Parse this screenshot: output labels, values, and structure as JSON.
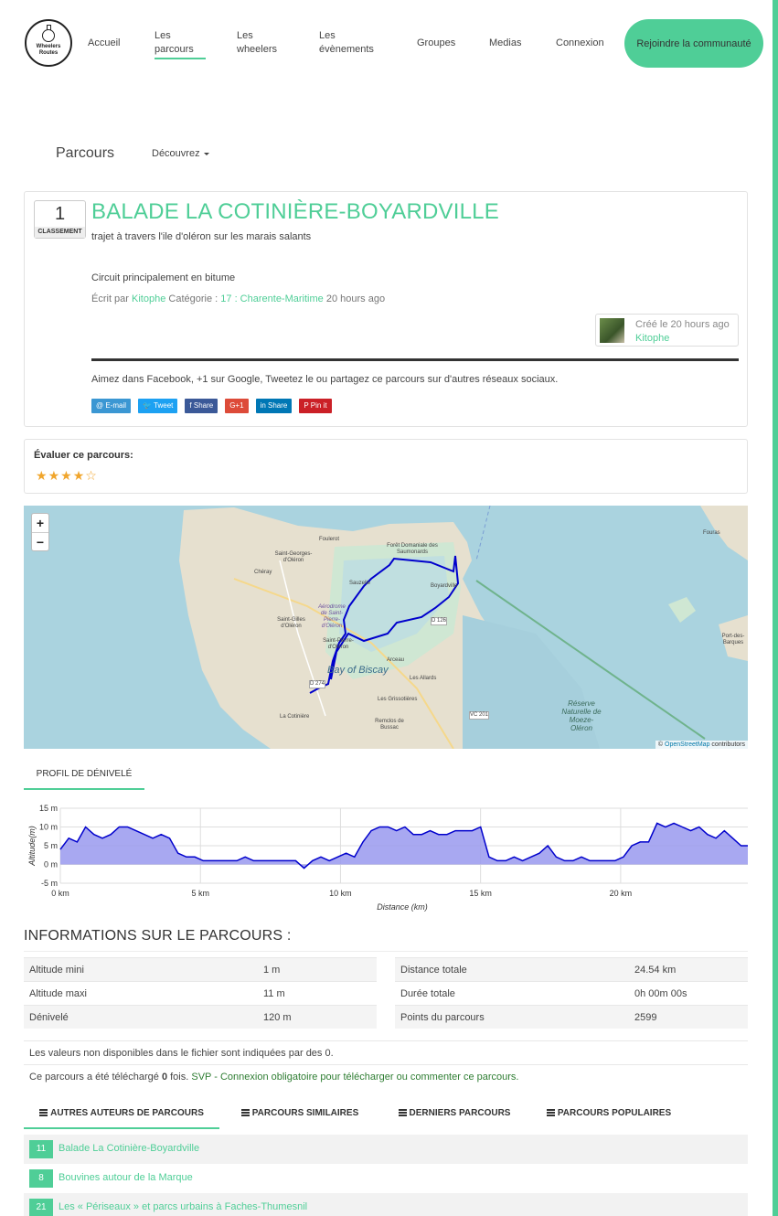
{
  "header": {
    "logo_line1": "Wheelers",
    "logo_line2": "Routes",
    "nav": [
      {
        "label": "Accueil"
      },
      {
        "label": "Les parcours"
      },
      {
        "label": "Les wheelers"
      },
      {
        "label": "Les évènements"
      },
      {
        "label": "Groupes"
      },
      {
        "label": "Medias"
      },
      {
        "label": "Connexion"
      }
    ],
    "join_label": "Rejoindre la communauté",
    "accent_color": "#4fce97"
  },
  "section": {
    "title": "Parcours",
    "discover_label": "Découvrez"
  },
  "route": {
    "rank": "1",
    "rank_label": "CLASSEMENT",
    "title": "BALADE LA COTINIÈRE-BOYARDVILLE",
    "subtitle": "trajet à travers l'ile d'oléron sur les marais salants",
    "description": "Circuit principalement en bitume",
    "written_by": "Écrit par",
    "author": "Kitophe",
    "category_label": "Catégorie :",
    "category": "17 : Charente-Maritime",
    "time_ago": "20 hours ago",
    "created": "Créé le 20 hours ago",
    "share_text": "Aimez dans Facebook, +1 sur Google, Tweetez le ou partagez ce parcours sur d'autres réseaux sociaux.",
    "share_buttons": [
      {
        "label": "@ E-mail",
        "color": "#3b97d3"
      },
      {
        "label": "🐦 Tweet",
        "color": "#1da1f2"
      },
      {
        "label": "f Share",
        "color": "#3b5998"
      },
      {
        "label": "G+1",
        "color": "#dd4b39"
      },
      {
        "label": "in Share",
        "color": "#0077b5"
      },
      {
        "label": "P Pin it",
        "color": "#cb2027"
      }
    ]
  },
  "rating": {
    "title": "Évaluer ce parcours:",
    "value": 4,
    "max": 5
  },
  "map": {
    "zoom_in": "+",
    "zoom_out": "−",
    "attribution_prefix": "©",
    "attribution_link": "OpenStreetMap",
    "attribution_suffix": "contributors",
    "labels": {
      "fouras": "Fouras",
      "foret": "Forêt Domaniale des Saumonards",
      "stgeorges": "Saint-Georges-d'Oléron",
      "cheray": "Chéray",
      "sauzelle": "Sauzelle",
      "boyard": "Boyardville",
      "stgilles": "Saint-Gilles d'Oléron",
      "aero": "Aérodrome de Saint-Pierre-d'Oléron",
      "stpierre": "Saint-Pierre-d'Oléron",
      "arceau": "Arceau",
      "bay": "Bay of Biscay",
      "allards": "Les Allards",
      "grissotieres": "Les Grissotières",
      "cotiniere": "La Cotinière",
      "remigeasse": "Remclos de Bussac",
      "reserve": "Réserve Naturelle de Moeze-Oléron",
      "port": "Port-des-Barques",
      "foulerot": "Foulerot",
      "d126": "D 126",
      "d274": "D 274",
      "vc201": "VC 201"
    }
  },
  "elevation": {
    "tab_label": "PROFIL DE DÉNIVELÉ",
    "ylabel": "Altitude(m)",
    "xlabel": "Distance (km)",
    "y_ticks": [
      "15 m",
      "10 m",
      "5 m",
      "0 m",
      "-5 m"
    ],
    "x_ticks": [
      "0 km",
      "5 km",
      "10 km",
      "15 km",
      "20 km"
    ],
    "fill_color": "#9999ee",
    "line_color": "#0000cc"
  },
  "chart_data": {
    "type": "area",
    "title": "",
    "xlabel": "Distance (km)",
    "ylabel": "Altitude(m)",
    "xlim": [
      0,
      24.54
    ],
    "ylim": [
      -5,
      15
    ],
    "x": [
      0,
      0.3,
      0.6,
      0.9,
      1.2,
      1.5,
      1.8,
      2.1,
      2.4,
      2.7,
      3.0,
      3.3,
      3.6,
      3.9,
      4.2,
      4.5,
      4.8,
      5.1,
      5.4,
      5.7,
      6.0,
      6.3,
      6.6,
      6.9,
      7.2,
      7.5,
      7.8,
      8.1,
      8.4,
      8.7,
      9.0,
      9.3,
      9.6,
      9.9,
      10.2,
      10.5,
      10.8,
      11.1,
      11.4,
      11.7,
      12.0,
      12.3,
      12.6,
      12.9,
      13.2,
      13.5,
      13.8,
      14.1,
      14.4,
      14.7,
      15.0,
      15.3,
      15.6,
      15.9,
      16.2,
      16.5,
      16.8,
      17.1,
      17.4,
      17.7,
      18.0,
      18.3,
      18.6,
      18.9,
      19.2,
      19.5,
      19.8,
      20.1,
      20.4,
      20.7,
      21.0,
      21.3,
      21.6,
      21.9,
      22.2,
      22.5,
      22.8,
      23.1,
      23.4,
      23.7,
      24.0,
      24.3,
      24.54
    ],
    "series": [
      {
        "values": [
          4,
          7,
          6,
          10,
          8,
          7,
          8,
          10,
          10,
          9,
          8,
          7,
          8,
          7,
          3,
          2,
          2,
          1,
          1,
          1,
          1,
          1,
          2,
          1,
          1,
          1,
          1,
          1,
          1,
          -1,
          1,
          2,
          1,
          2,
          3,
          2,
          6,
          9,
          10,
          10,
          9,
          10,
          8,
          8,
          9,
          8,
          8,
          9,
          9,
          9,
          10,
          2,
          1,
          1,
          2,
          1,
          2,
          3,
          5,
          2,
          1,
          1,
          2,
          1,
          1,
          1,
          1,
          2,
          5,
          6,
          6,
          11,
          10,
          11,
          10,
          9,
          10,
          8,
          7,
          9,
          7,
          5,
          5
        ]
      }
    ]
  },
  "info": {
    "title": "INFORMATIONS SUR LE PARCOURS :",
    "left": [
      {
        "label": "Altitude mini",
        "value": "1 m"
      },
      {
        "label": "Altitude maxi",
        "value": "11 m"
      },
      {
        "label": "Dénivelé",
        "value": "120 m"
      }
    ],
    "right": [
      {
        "label": "Distance totale",
        "value": "24.54 km"
      },
      {
        "label": "Durée totale",
        "value": "0h 00m 00s"
      },
      {
        "label": "Points du parcours",
        "value": "2599"
      }
    ],
    "note1": "Les valeurs non disponibles dans le fichier sont indiquées par des 0.",
    "note2_prefix": "Ce parcours a été téléchargé",
    "note2_count": "0",
    "note2_suffix": "fois.",
    "note2_link": "SVP - Connexion obligatoire pour télécharger ou commenter ce parcours."
  },
  "tabs": [
    {
      "label": "AUTRES AUTEURS DE PARCOURS"
    },
    {
      "label": "PARCOURS SIMILAIRES"
    },
    {
      "label": "DERNIERS PARCOURS"
    },
    {
      "label": "PARCOURS POPULAIRES"
    }
  ],
  "list": [
    {
      "badge": "11",
      "title": "Balade La Cotinière-Boyardville"
    },
    {
      "badge": "8",
      "title": "Bouvines autour de la Marque"
    },
    {
      "badge": "21",
      "title": "Les « Périseaux » et parcs urbains à Faches-Thumesnil"
    }
  ]
}
